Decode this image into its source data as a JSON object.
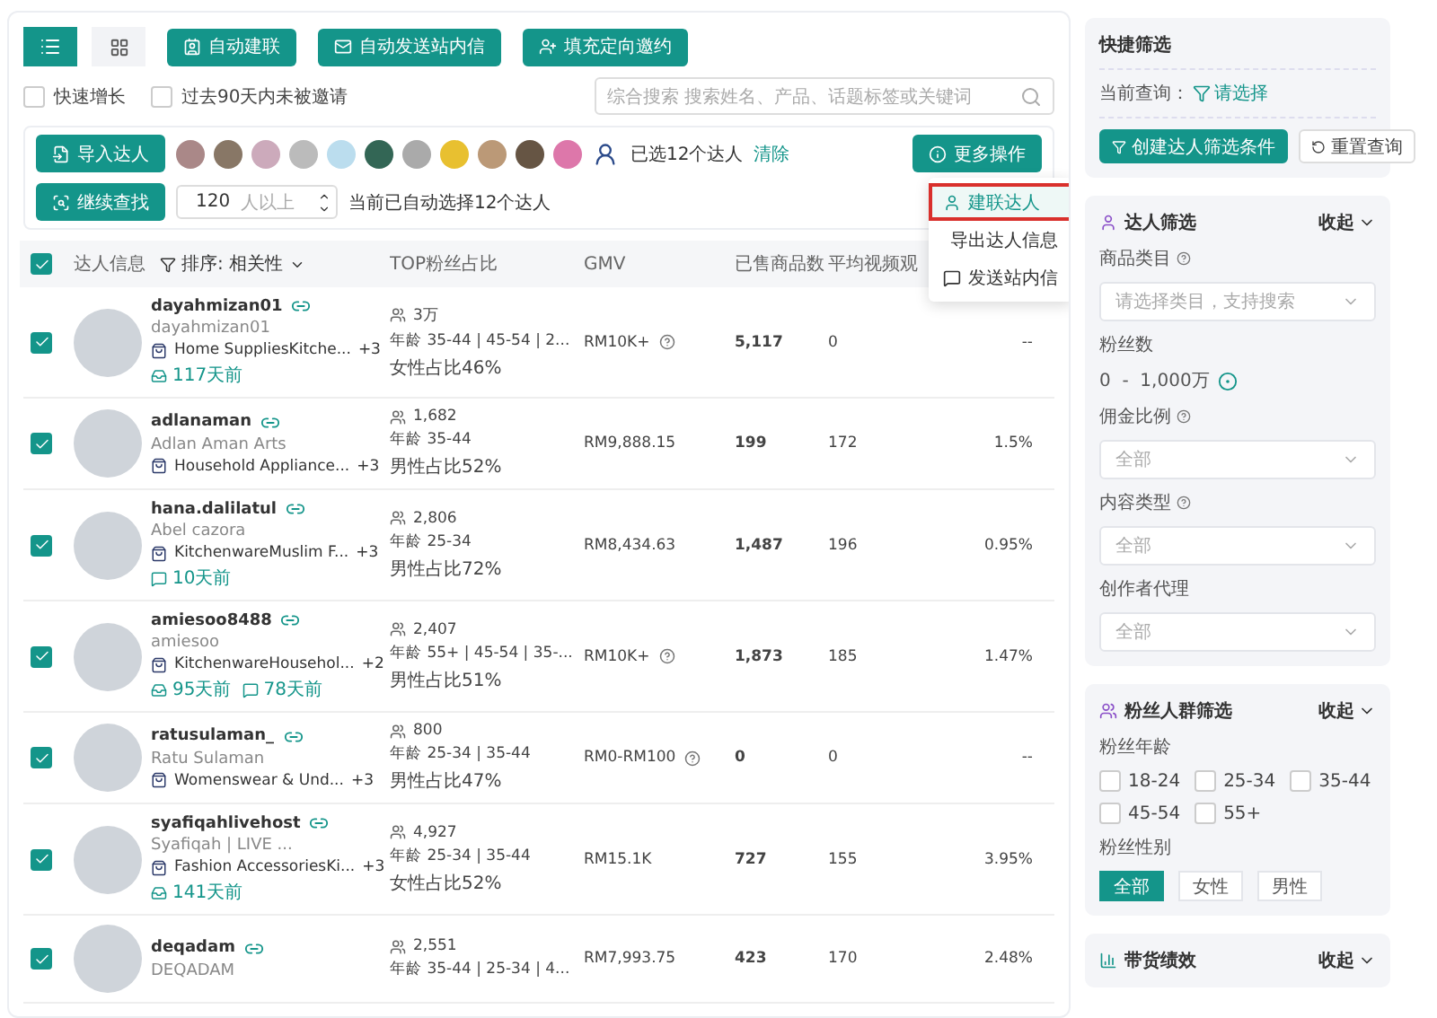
{
  "view_toggle": [
    {
      "kind": "list",
      "selected": true
    },
    {
      "kind": "grid",
      "selected": false
    }
  ],
  "actions": [
    {
      "kind": "connect",
      "label": "自动建联"
    },
    {
      "kind": "mail",
      "label": "自动发送站内信"
    },
    {
      "kind": "invite",
      "label": "填充定向邀约"
    }
  ],
  "filters": [
    {
      "label": "快速增长",
      "checked": false
    },
    {
      "label": "过去90天内未被邀请",
      "checked": false
    }
  ],
  "search": {
    "placeholder": "综合搜索 搜索姓名、产品、话题标签或关键词"
  },
  "selection": {
    "import_button": "导入达人",
    "avatars": [
      {
        "kind": "photo"
      },
      {
        "kind": "photo"
      },
      {
        "kind": "photo"
      },
      {
        "kind": "photo"
      },
      {
        "kind": "photo"
      },
      {
        "kind": "photo"
      },
      {
        "kind": "photo"
      },
      {
        "kind": "photo"
      },
      {
        "kind": "photo"
      },
      {
        "kind": "photo"
      },
      {
        "kind": "photo"
      },
      {
        "kind": "person"
      }
    ],
    "selected_text": "已选12个达人",
    "clear_link": "清除",
    "more_button": "更多操作",
    "continue_button": "继续查找",
    "count_value": "120",
    "count_suffix": "人以上",
    "auto_text": "当前已自动选择12个达人"
  },
  "menu": [
    {
      "kind": "user",
      "label": "建联达人",
      "selected": true
    },
    {
      "kind": "export",
      "label": "导出达人信息",
      "selected": false
    },
    {
      "kind": "message",
      "label": "发送站内信",
      "selected": false
    }
  ],
  "table": {
    "all_checked": true,
    "columns": [
      "达人信息",
      "TOP粉丝占比",
      "GMV",
      "已售商品数",
      "平均视频观"
    ],
    "sort": "排序: 相关性",
    "rows": [
      {
        "checked": true,
        "name": "dayahmizan01",
        "handle": "dayahmizan01",
        "category": "Home SuppliesKitche...",
        "more": "+3",
        "tags": [
          {
            "kind": "sample",
            "text": "117天前"
          }
        ],
        "fans": "3万",
        "age": "年龄 35-44 | 45-54 | 2...",
        "gender": "女性占比46%",
        "gmv": "RM10K+",
        "gmv_info": true,
        "sold": "5,117",
        "views": "0",
        "rate": "--"
      },
      {
        "checked": true,
        "name": "adlanaman",
        "handle": "Adlan Aman Arts",
        "category": "Household Appliance...",
        "more": "+3",
        "fans": "1,682",
        "age": "年龄 35-44",
        "gender": "男性占比52%",
        "gmv": "RM9,888.15",
        "gmv_info": false,
        "sold": "199",
        "views": "172",
        "rate": "1.5%"
      },
      {
        "checked": true,
        "name": "hana.dalilatul",
        "handle": "Abel cazora",
        "category": "KitchenwareMuslim F...",
        "more": "+3",
        "tags": [
          {
            "kind": "message",
            "text": "10天前"
          }
        ],
        "fans": "2,806",
        "age": "年龄 25-34",
        "gender": "男性占比72%",
        "gmv": "RM8,434.63",
        "gmv_info": false,
        "sold": "1,487",
        "views": "196",
        "rate": "0.95%"
      },
      {
        "checked": true,
        "name": "amiesoo8488",
        "handle": "amiesoo",
        "category": "KitchenwareHousehol...",
        "more": "+2",
        "tags": [
          {
            "kind": "sample",
            "text": "95天前"
          },
          {
            "kind": "message",
            "text": "78天前"
          }
        ],
        "fans": "2,407",
        "age": "年龄 55+ | 45-54 | 35-...",
        "gender": "男性占比51%",
        "gmv": "RM10K+",
        "gmv_info": true,
        "sold": "1,873",
        "views": "185",
        "rate": "1.47%"
      },
      {
        "checked": true,
        "name": "ratusulaman_",
        "handle": "Ratu Sulaman",
        "category": "Womenswear & Und...",
        "more": "+3",
        "fans": "800",
        "age": "年龄 25-34 | 35-44",
        "gender": "男性占比47%",
        "gmv": "RM0-RM100",
        "gmv_info": true,
        "sold": "0",
        "views": "0",
        "rate": "--"
      },
      {
        "checked": true,
        "name": "syafiqahlivehost",
        "handle": "Syafiqah | LIVE ...",
        "category": "Fashion AccessoriesKi...",
        "more": "+3",
        "tags": [
          {
            "kind": "sample",
            "text": "141天前"
          }
        ],
        "fans": "4,927",
        "age": "年龄 25-34 | 35-44",
        "gender": "女性占比52%",
        "gmv": "RM15.1K",
        "gmv_info": false,
        "sold": "727",
        "views": "155",
        "rate": "3.95%"
      },
      {
        "checked": true,
        "name": "deqadam",
        "handle": "DEQADAM",
        "fans": "2,551",
        "age": "年龄 35-44 | 25-34 | 4...",
        "gmv": "RM7,993.75",
        "gmv_info": false,
        "sold": "423",
        "views": "170",
        "rate": "2.48%"
      }
    ]
  },
  "sidebar": {
    "quick": {
      "title": "快捷筛选",
      "query_label": "当前查询：",
      "query_value": "请选择",
      "create_button": "创建达人筛选条件",
      "reset_button": "重置查询"
    },
    "creator": {
      "title": "达人筛选",
      "collapse": "收起",
      "category_label": "商品类目",
      "category_placeholder": "请选择类目，支持搜索",
      "fans_label": "粉丝数",
      "fans_range": "0  -  1,000万",
      "commission_label": "佣金比例",
      "commission_value": "全部",
      "content_label": "内容类型",
      "content_value": "全部",
      "agency_label": "创作者代理",
      "agency_value": "全部"
    },
    "audience": {
      "title": "粉丝人群筛选",
      "collapse": "收起",
      "age_label": "粉丝年龄",
      "ages": [
        {
          "label": "18-24",
          "checked": false
        },
        {
          "label": "25-34",
          "checked": false
        },
        {
          "label": "35-44",
          "checked": false
        },
        {
          "label": "45-54",
          "checked": false
        },
        {
          "label": "55+",
          "checked": false
        }
      ],
      "gender_label": "粉丝性别",
      "genders": [
        {
          "label": "全部",
          "selected": true
        },
        {
          "label": "女性",
          "selected": false
        },
        {
          "label": "男性",
          "selected": false
        }
      ]
    },
    "performance": {
      "title": "带货绩效",
      "collapse": "收起"
    }
  }
}
